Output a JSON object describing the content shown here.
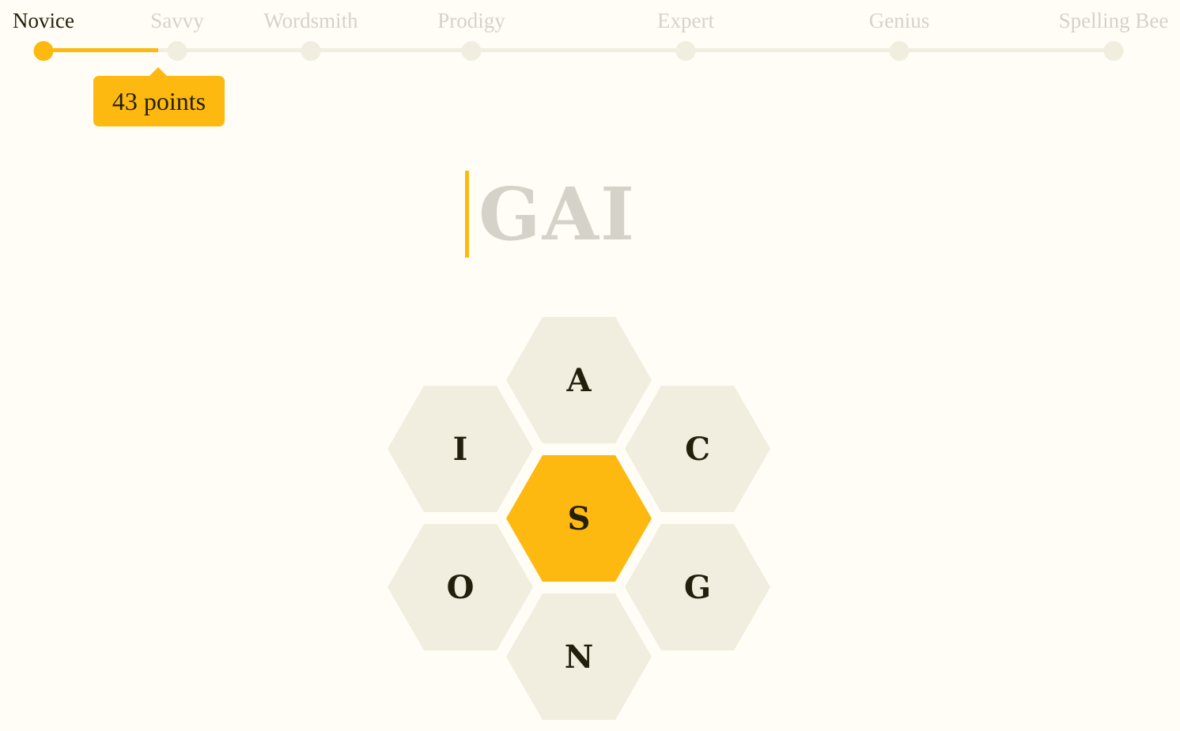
{
  "progress": {
    "ranks": [
      {
        "label": "Novice",
        "active": true
      },
      {
        "label": "Savvy",
        "active": false
      },
      {
        "label": "Wordsmith",
        "active": false
      },
      {
        "label": "Prodigy",
        "active": false
      },
      {
        "label": "Expert",
        "active": false
      },
      {
        "label": "Genius",
        "active": false
      },
      {
        "label": "Spelling Bee",
        "active": false
      }
    ],
    "current_rank": "Novice",
    "fill_fraction_to_next_rank": 0.86,
    "points_label": "43 points",
    "colors": {
      "accent": "#fdb90f",
      "inactive": "#f1eee0",
      "inactive_text": "#d5d3c9",
      "active_text": "#231f0d"
    }
  },
  "input": {
    "current_word": "GAI",
    "cursor_icon": "text-cursor-icon"
  },
  "hive": {
    "center_letter": "S",
    "outer_letters": {
      "top": "A",
      "upper_right": "C",
      "lower_right": "G",
      "bottom": "N",
      "lower_left": "O",
      "upper_left": "I"
    },
    "colors": {
      "center": "#fdb90f",
      "outer": "#f1eee0",
      "letter": "#231f0d",
      "background": "#fffdf5"
    }
  }
}
